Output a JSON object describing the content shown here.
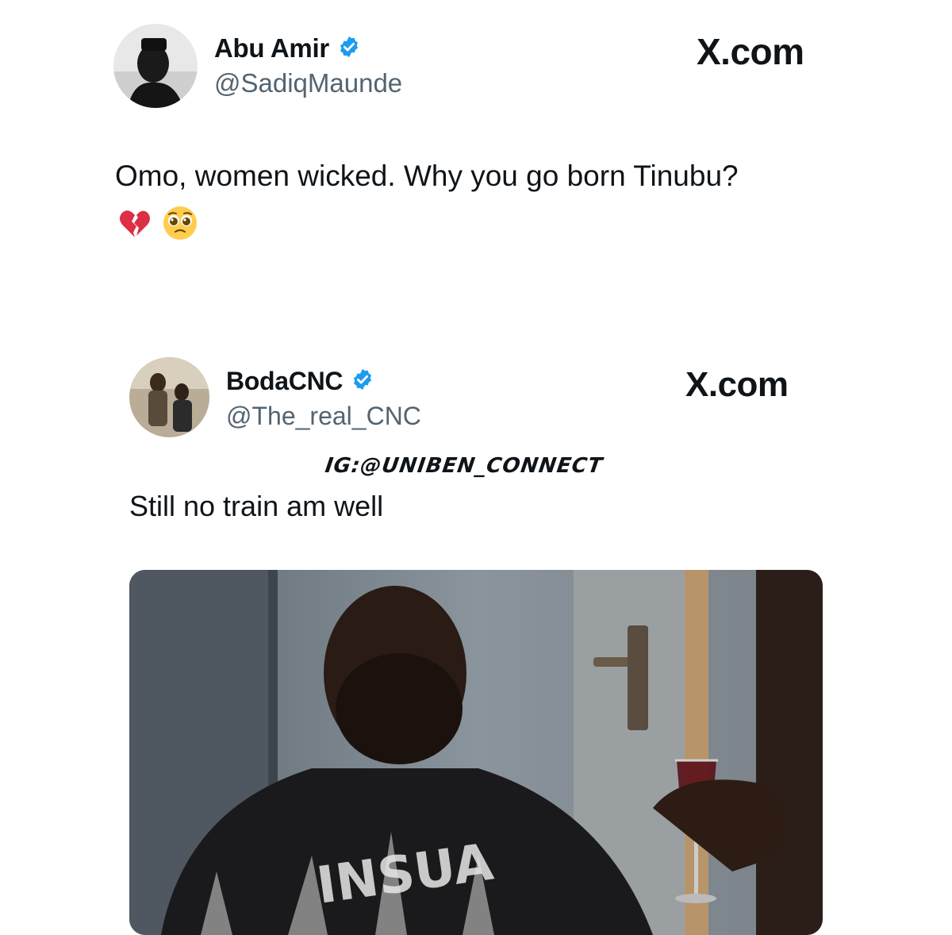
{
  "tweet1": {
    "display_name": "Abu Amir",
    "handle": "@SadiqMaunde",
    "brand": "X.com",
    "text": "Omo, women wicked. Why you go born Tinubu?",
    "emojis": [
      "broken-heart-emoji",
      "pleading-face-emoji"
    ]
  },
  "tweet2": {
    "display_name": "BodaCNC",
    "handle": "@The_real_CNC",
    "brand": "X.com",
    "watermark": "IG:@UNIBEN_CONNECT",
    "text": "Still no train am well",
    "media": "man-with-wine-glass-photo",
    "shirt_text": "INSUA"
  },
  "colors": {
    "verified": "#1d9bf0",
    "handle": "#536471",
    "text": "#0f1419"
  }
}
